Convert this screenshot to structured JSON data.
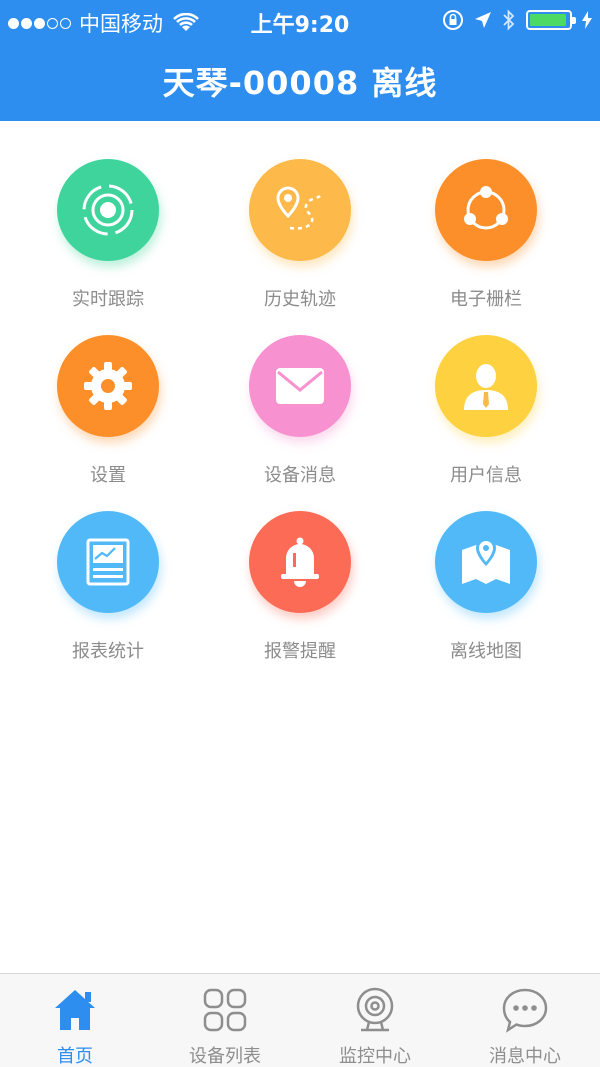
{
  "status_bar": {
    "carrier": "中国移动",
    "time": "上午9:20"
  },
  "header": {
    "title": "天琴-00008 离线"
  },
  "grid": {
    "items": [
      {
        "label": "实时跟踪",
        "icon": "radar-icon",
        "color": "#3ed49c"
      },
      {
        "label": "历史轨迹",
        "icon": "route-pin-icon",
        "color": "#fdb94a"
      },
      {
        "label": "电子栅栏",
        "icon": "share-nodes-icon",
        "color": "#fc8f2a"
      },
      {
        "label": "设置",
        "icon": "gear-icon",
        "color": "#fc8f2a"
      },
      {
        "label": "设备消息",
        "icon": "envelope-icon",
        "color": "#f791cf"
      },
      {
        "label": "用户信息",
        "icon": "user-icon",
        "color": "#fdd13f"
      },
      {
        "label": "报表统计",
        "icon": "report-chart-icon",
        "color": "#51b9f8"
      },
      {
        "label": "报警提醒",
        "icon": "bell-icon",
        "color": "#fc6b55"
      },
      {
        "label": "离线地图",
        "icon": "map-pin-icon",
        "color": "#51b9f8"
      }
    ]
  },
  "tabbar": {
    "tabs": [
      {
        "label": "首页",
        "icon": "home-icon",
        "active": true
      },
      {
        "label": "设备列表",
        "icon": "grid-squares-icon",
        "active": false
      },
      {
        "label": "监控中心",
        "icon": "webcam-icon",
        "active": false
      },
      {
        "label": "消息中心",
        "icon": "chat-bubble-icon",
        "active": false
      }
    ]
  },
  "colors": {
    "brand": "#2d8ef0",
    "label_gray": "#8c8c8c",
    "tab_gray": "#8e8e8e"
  }
}
